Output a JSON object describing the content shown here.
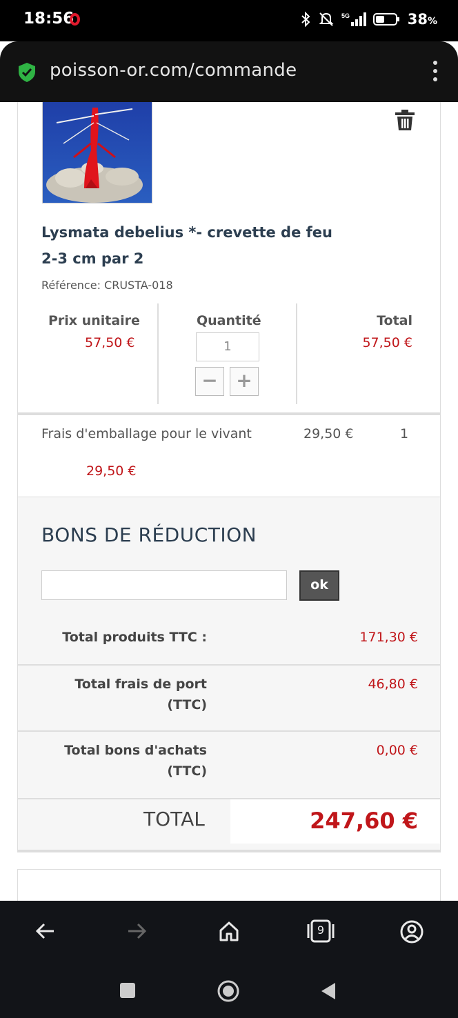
{
  "status": {
    "time": "18:56",
    "battery": "38"
  },
  "browser": {
    "url": "poisson-or.com/commande"
  },
  "product": {
    "name": "Lysmata debelius *- crevette de feu 2-3 cm par 2",
    "reference": "Référence: CRUSTA-018",
    "unit_price_label": "Prix unitaire",
    "unit_price": "57,50 €",
    "quantity_label": "Quantité",
    "quantity": "1",
    "total_label": "Total",
    "total": "57,50 €",
    "minus_label": "−",
    "plus_label": "+"
  },
  "fee": {
    "label": "Frais d'emballage pour le vivant",
    "amount": "29,50 €",
    "quantity": "1",
    "total": "29,50 €"
  },
  "coupons": {
    "title": "BONS DE RÉDUCTION",
    "input_value": "",
    "ok_label": "ok"
  },
  "totals": {
    "products_label": "Total produits TTC :",
    "products_value": "171,30 €",
    "shipping_label": "Total frais de port (TTC)",
    "shipping_value": "46,80 €",
    "vouchers_label": "Total bons d'achats (TTC)",
    "vouchers_value": "0,00 €",
    "grand_label": "TOTAL",
    "grand_value": "247,60 €"
  },
  "nav": {
    "tabs_count": "9"
  },
  "colors": {
    "price_red": "#c0161a",
    "heading_blue": "#2c3e50",
    "shield_green": "#2fb344"
  }
}
